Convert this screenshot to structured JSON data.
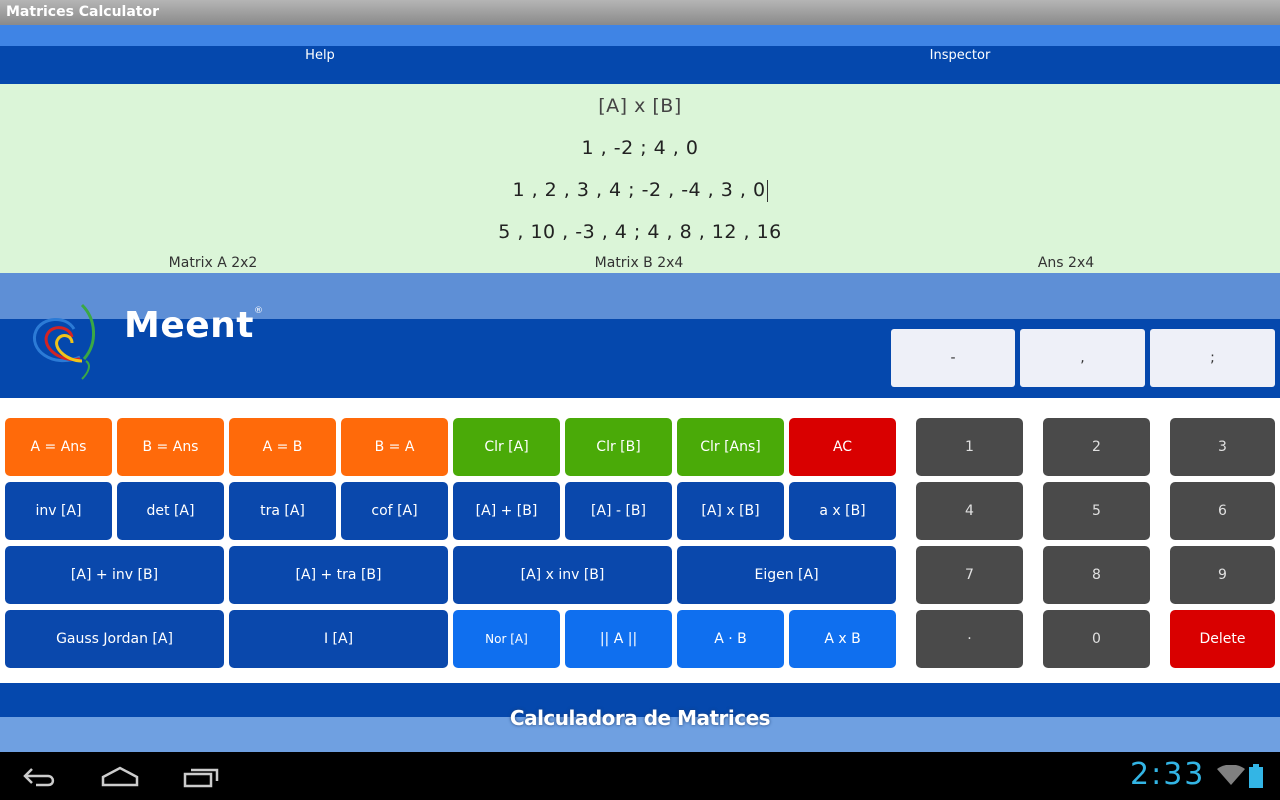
{
  "app": {
    "title": "Matrices Calculator"
  },
  "nav": {
    "tabs": [
      {
        "label": "Help"
      },
      {
        "label": "Inspector"
      }
    ]
  },
  "display": {
    "operation": "[A] x [B]",
    "matrix_a": "1 , -2 ; 4 , 0",
    "matrix_b": "1 , 2 , 3 , 4 ; -2 , -4 , 3 , 0",
    "answer": "5 , 10 , -3 , 4 ; 4 , 8 , 12 , 16",
    "labels": {
      "a": "Matrix A 2x2",
      "b": "Matrix B 2x4",
      "ans": "Ans 2x4"
    }
  },
  "logo": {
    "text": "Meent",
    "reg": "®"
  },
  "symbols": {
    "minus": "-",
    "comma": ",",
    "semicolon": ";"
  },
  "functions": {
    "row1": [
      "A = Ans",
      "B = Ans",
      "A = B",
      "B = A",
      "Clr [A]",
      "Clr [B]",
      "Clr [Ans]",
      "AC"
    ],
    "row2": [
      "inv [A]",
      "det [A]",
      "tra [A]",
      "cof [A]",
      "[A] + [B]",
      "[A] - [B]",
      "[A] x [B]",
      "a x [B]"
    ],
    "row3": [
      "[A] + inv [B]",
      "[A] + tra [B]",
      "[A] x inv [B]",
      "Eigen [A]"
    ],
    "row4": [
      "Gauss Jordan [A]",
      "I [A]",
      "Nor [A]",
      "|| A ||",
      "A · B",
      "A x B"
    ]
  },
  "keypad": {
    "keys": [
      "1",
      "2",
      "3",
      "4",
      "5",
      "6",
      "7",
      "8",
      "9",
      "·",
      "0"
    ],
    "delete": "Delete"
  },
  "footer": {
    "text": "Calculadora de Matrices"
  },
  "system": {
    "clock": "2:33"
  },
  "colors": {
    "orange": "#ff6a0a",
    "green": "#4aaa08",
    "red": "#d90000",
    "blue": "#0a48ac",
    "light_blue": "#0f6fef",
    "gray": "#4a4a4a",
    "display_bg": "#dbf5d8",
    "clock": "#33b5e5"
  }
}
